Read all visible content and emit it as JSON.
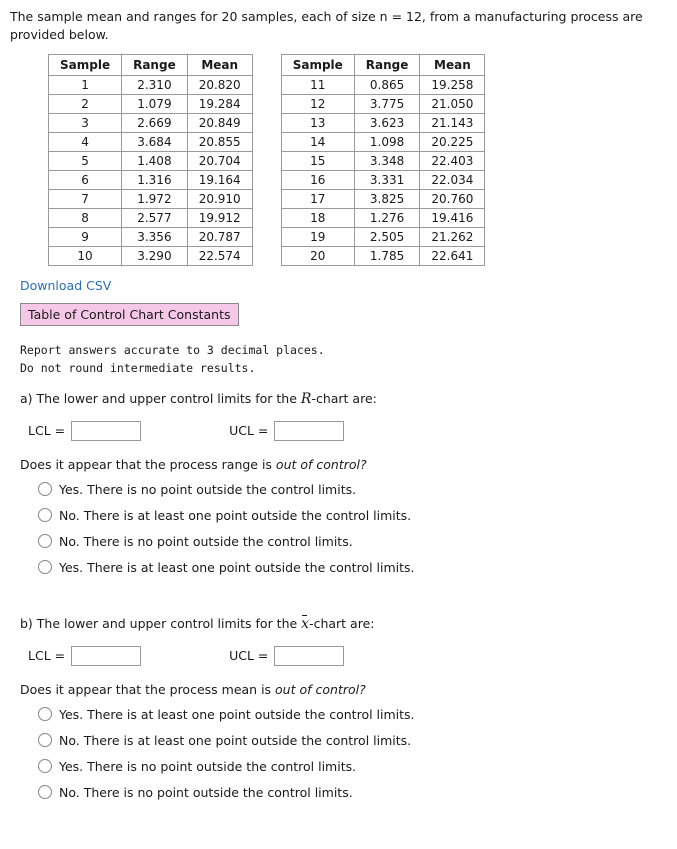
{
  "intro": "The sample mean and ranges for 20 samples, each of size n = 12, from a manufacturing process are provided below.",
  "table": {
    "headers": [
      "Sample",
      "Range",
      "Mean"
    ],
    "left_rows": [
      [
        "1",
        "2.310",
        "20.820"
      ],
      [
        "2",
        "1.079",
        "19.284"
      ],
      [
        "3",
        "2.669",
        "20.849"
      ],
      [
        "4",
        "3.684",
        "20.855"
      ],
      [
        "5",
        "1.408",
        "20.704"
      ],
      [
        "6",
        "1.316",
        "19.164"
      ],
      [
        "7",
        "1.972",
        "20.910"
      ],
      [
        "8",
        "2.577",
        "19.912"
      ],
      [
        "9",
        "3.356",
        "20.787"
      ],
      [
        "10",
        "3.290",
        "22.574"
      ]
    ],
    "right_rows": [
      [
        "11",
        "0.865",
        "19.258"
      ],
      [
        "12",
        "3.775",
        "21.050"
      ],
      [
        "13",
        "3.623",
        "21.143"
      ],
      [
        "14",
        "1.098",
        "20.225"
      ],
      [
        "15",
        "3.348",
        "22.403"
      ],
      [
        "16",
        "3.331",
        "22.034"
      ],
      [
        "17",
        "3.825",
        "20.760"
      ],
      [
        "18",
        "1.276",
        "19.416"
      ],
      [
        "19",
        "2.505",
        "21.262"
      ],
      [
        "20",
        "1.785",
        "22.641"
      ]
    ]
  },
  "download_label": "Download CSV",
  "constants_label": "Table of Control Chart Constants",
  "note_line1": "Report answers accurate to 3 decimal places.",
  "note_line2": "Do not round intermediate results.",
  "part_a": {
    "prompt_pre": "a) The lower and upper control limits for the ",
    "prompt_sym": "R",
    "prompt_post": "-chart are:",
    "lcl_label": "LCL =",
    "ucl_label": "UCL =",
    "lcl_value": "",
    "ucl_value": "",
    "question_pre": "Does it appear that the process range is ",
    "question_ital": "out of control?",
    "options": [
      "Yes. There is no point outside the control limits.",
      "No. There is at least one point outside the control limits.",
      "No. There is no point outside the control limits.",
      "Yes. There is at least one point outside the control limits."
    ]
  },
  "part_b": {
    "prompt_pre": "b) The lower and upper control limits for the ",
    "prompt_sym": "x",
    "prompt_post": "-chart are:",
    "lcl_label": "LCL =",
    "ucl_label": "UCL =",
    "lcl_value": "",
    "ucl_value": "",
    "question_pre": "Does it appear that the process mean is ",
    "question_ital": "out of control?",
    "options": [
      "Yes. There is at least one point outside the control limits.",
      "No. There is at least one point outside the control limits.",
      "Yes. There is no point outside the control limits.",
      "No. There is no point outside the control limits."
    ]
  }
}
